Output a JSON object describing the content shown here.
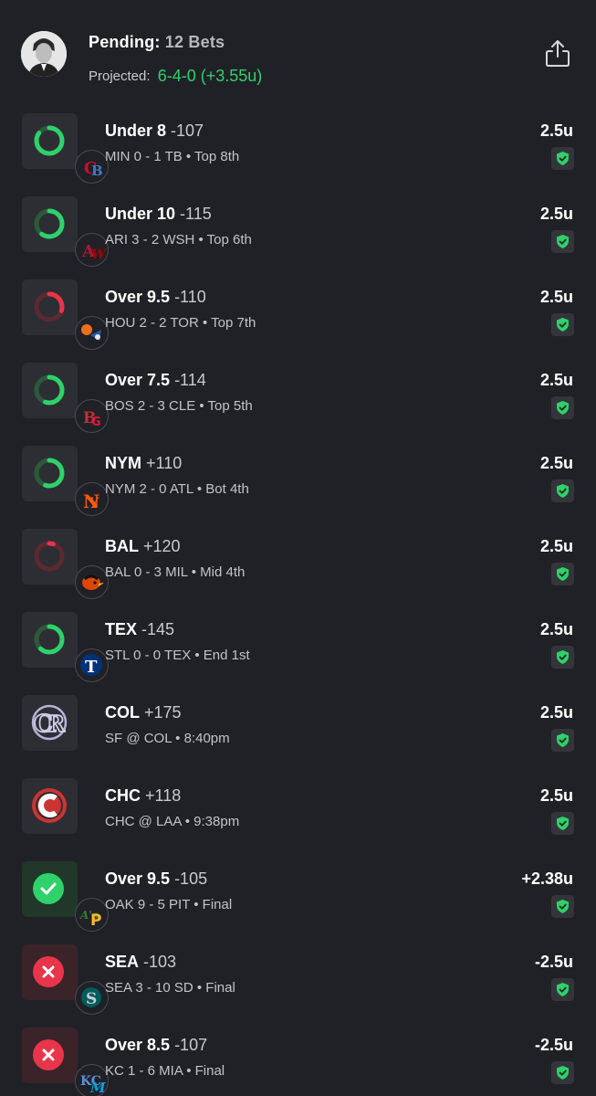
{
  "header": {
    "title_label": "Pending:",
    "title_count": "12 Bets",
    "projected_label": "Projected:",
    "projected_value": "6-4-0 (+3.55u)"
  },
  "colors": {
    "background": "#202126",
    "accent_green": "#2fd16b",
    "loss_red": "#e8354a"
  },
  "bets": [
    {
      "pick": "Under 8",
      "odds": "-107",
      "score": "MIN 0 - 1 TB • Top 8th",
      "units": "2.5u",
      "status": "live",
      "ring": "green",
      "ring_fraction": 0.85,
      "logo": "twins-rays-logo-icon"
    },
    {
      "pick": "Under 10",
      "odds": "-115",
      "score": "ARI 3 - 2 WSH • Top 6th",
      "units": "2.5u",
      "status": "live",
      "ring": "green",
      "ring_fraction": 0.6,
      "logo": "dbacks-nationals-logo-icon"
    },
    {
      "pick": "Over 9.5",
      "odds": "-110",
      "score": "HOU 2 - 2 TOR • Top 7th",
      "units": "2.5u",
      "status": "live",
      "ring": "red",
      "ring_fraction": 0.3,
      "logo": "astros-bluejays-logo-icon"
    },
    {
      "pick": "Over 7.5",
      "odds": "-114",
      "score": "BOS 2 - 3 CLE • Top 5th",
      "units": "2.5u",
      "status": "live",
      "ring": "green",
      "ring_fraction": 0.55,
      "logo": "redsox-guardians-logo-icon"
    },
    {
      "pick": "NYM",
      "odds": "+110",
      "score": "NYM 2 - 0 ATL • Bot 4th",
      "units": "2.5u",
      "status": "live",
      "ring": "green",
      "ring_fraction": 0.55,
      "logo": "mets-logo-icon"
    },
    {
      "pick": "BAL",
      "odds": "+120",
      "score": "BAL 0 - 3 MIL • Mid 4th",
      "units": "2.5u",
      "status": "live",
      "ring": "red",
      "ring_fraction": 0.05,
      "logo": "orioles-logo-icon"
    },
    {
      "pick": "TEX",
      "odds": "-145",
      "score": "STL 0 - 0 TEX • End 1st",
      "units": "2.5u",
      "status": "live",
      "ring": "green",
      "ring_fraction": 0.62,
      "logo": "rangers-logo-icon"
    },
    {
      "pick": "COL",
      "odds": "+175",
      "score": "SF @ COL • 8:40pm",
      "units": "2.5u",
      "status": "upcoming",
      "logo": "rockies-logo-icon"
    },
    {
      "pick": "CHC",
      "odds": "+118",
      "score": "CHC @ LAA • 9:38pm",
      "units": "2.5u",
      "status": "upcoming",
      "logo": "cubs-logo-icon"
    },
    {
      "pick": "Over 9.5",
      "odds": "-105",
      "score": "OAK 9 - 5 PIT • Final",
      "units": "+2.38u",
      "status": "win",
      "logo": "athletics-pirates-logo-icon"
    },
    {
      "pick": "SEA",
      "odds": "-103",
      "score": "SEA 3 - 10 SD • Final",
      "units": "-2.5u",
      "status": "loss",
      "logo": "mariners-logo-icon"
    },
    {
      "pick": "Over 8.5",
      "odds": "-107",
      "score": "KC 1 - 6 MIA • Final",
      "units": "-2.5u",
      "status": "loss",
      "logo": "royals-marlins-logo-icon"
    }
  ]
}
